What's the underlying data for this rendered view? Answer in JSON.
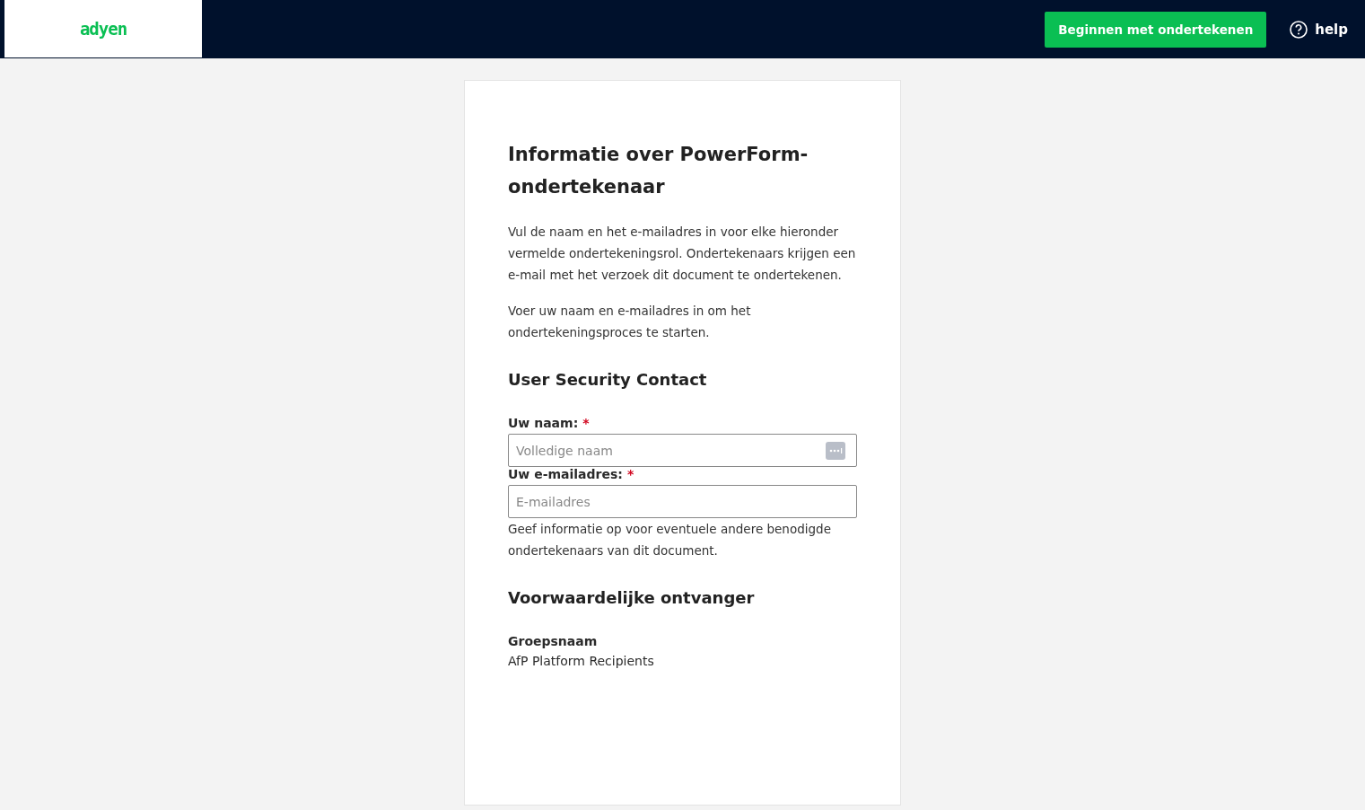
{
  "header": {
    "logo": "adyen",
    "start_button": "Beginnen met ondertekenen",
    "help_link": "help"
  },
  "form": {
    "title": "Informatie over PowerForm-ondertekenaar",
    "intro": [
      "Vul de naam en het e-mailadres in voor elke hieronder vermelde ondertekeningsrol. Ondertekenaars krijgen een e-mail met het verzoek dit document te ondertekenen.",
      "Voer uw naam en e-mailadres in om het ondertekeningsproces te starten."
    ],
    "role_title": "User Security Contact",
    "fields": [
      {
        "label": "Uw naam:",
        "required_mark": "*",
        "placeholder": "Volledige naam",
        "kind": "name"
      },
      {
        "label": "Uw e-mailadres:",
        "required_mark": "*",
        "placeholder": "E-mailadres",
        "kind": "email"
      }
    ],
    "other_info": "Geef informatie op voor eventuele andere benodigde ondertekenaars van dit document.",
    "recipient_title": "Voorwaardelijke ontvanger",
    "group_label": "Groepsnaam",
    "group_value": "AfP Platform Recipients"
  }
}
